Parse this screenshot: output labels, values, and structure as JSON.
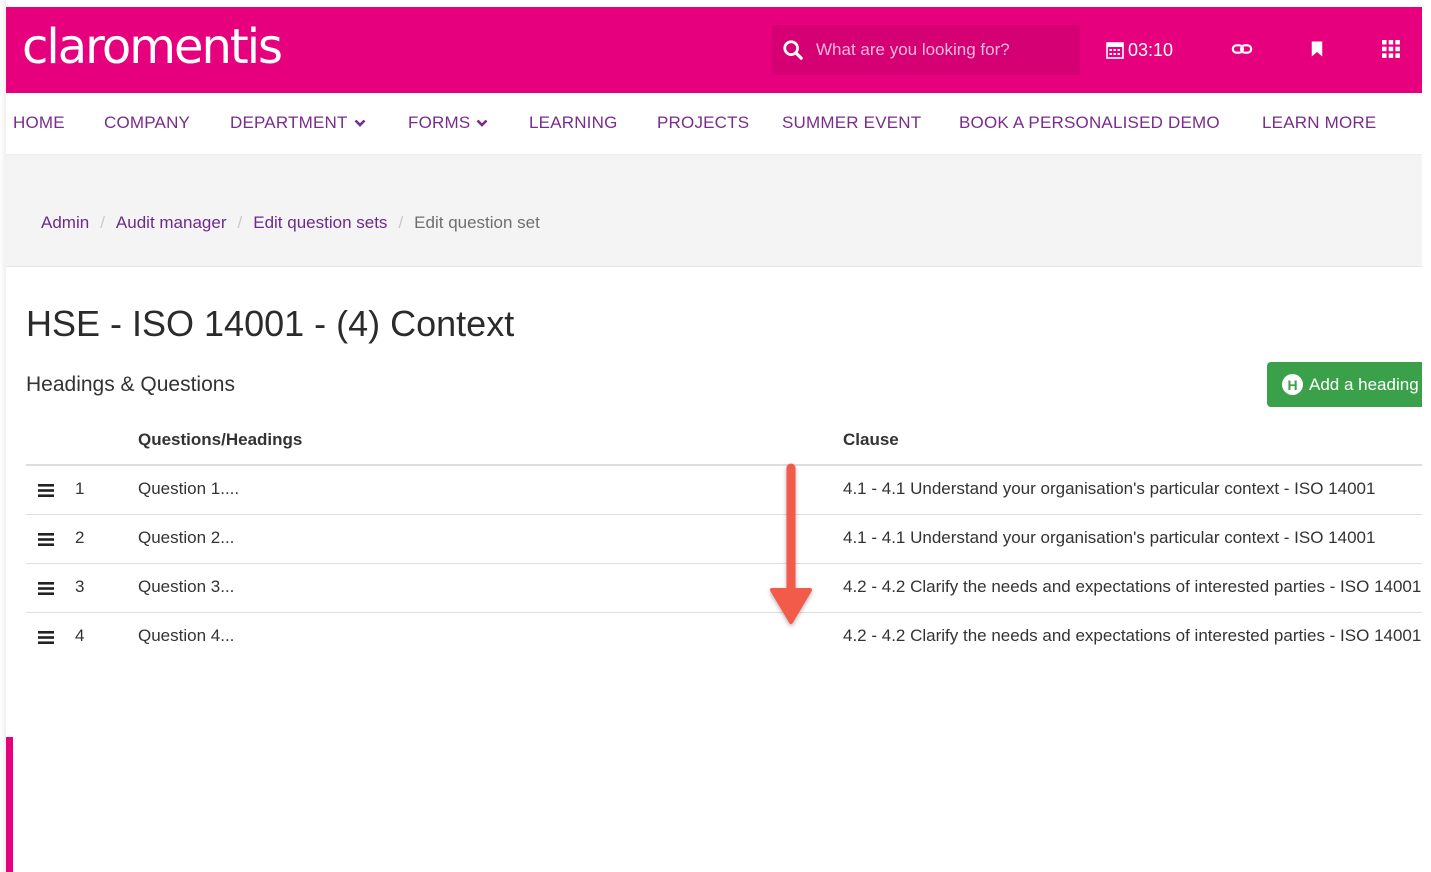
{
  "header": {
    "logo_text": "claromentis",
    "search_placeholder": "What are you looking for?",
    "clock_time": "03:10",
    "brand_color": "#e6007e",
    "icons": [
      "search-icon",
      "calendar-icon",
      "link-icon",
      "bookmark-icon",
      "apps-grid-icon"
    ]
  },
  "nav": {
    "items": [
      {
        "label": "HOME",
        "dropdown": false
      },
      {
        "label": "COMPANY",
        "dropdown": false
      },
      {
        "label": "DEPARTMENT",
        "dropdown": true
      },
      {
        "label": "FORMS",
        "dropdown": true
      },
      {
        "label": "LEARNING",
        "dropdown": false
      },
      {
        "label": "PROJECTS",
        "dropdown": false
      },
      {
        "label": "SUMMER EVENT",
        "dropdown": false
      },
      {
        "label": "BOOK A PERSONALISED DEMO",
        "dropdown": false
      },
      {
        "label": "LEARN MORE",
        "dropdown": false
      }
    ]
  },
  "breadcrumb": {
    "items": [
      "Admin",
      "Audit manager",
      "Edit question sets",
      "Edit question set"
    ]
  },
  "main": {
    "title": "HSE - ISO 14001 - (4) Context",
    "section_title": "Headings & Questions",
    "add_button_label": "Add a heading",
    "add_button_badge": "H",
    "table": {
      "headers": [
        "Questions/Headings",
        "Clause"
      ],
      "rows": [
        {
          "num": "1",
          "question": "Question 1....",
          "clause": "4.1 - 4.1 Understand your organisation's particular context - ISO 14001"
        },
        {
          "num": "2",
          "question": "Question 2...",
          "clause": "4.1 - 4.1 Understand your organisation's particular context - ISO 14001"
        },
        {
          "num": "3",
          "question": "Question 3...",
          "clause": "4.2 - 4.2 Clarify the needs and expectations of interested parties - ISO 14001"
        },
        {
          "num": "4",
          "question": "Question 4...",
          "clause": "4.2 - 4.2 Clarify the needs and expectations of interested parties - ISO 14001"
        }
      ]
    }
  },
  "annotation": {
    "arrow_color": "#f25a4a"
  }
}
